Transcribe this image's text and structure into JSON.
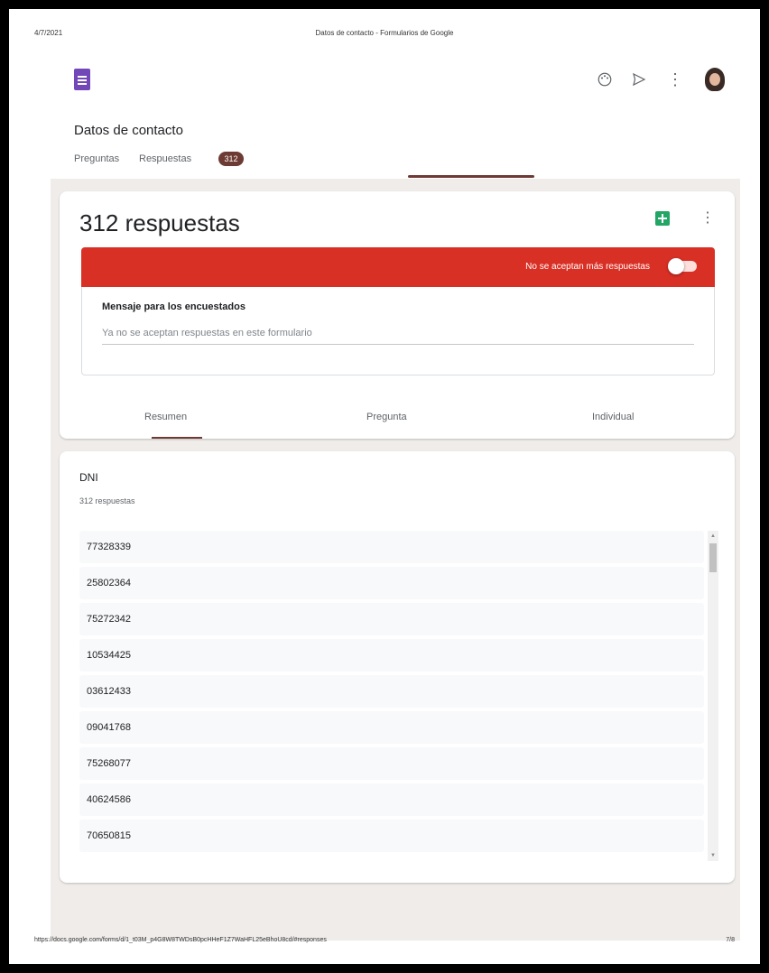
{
  "print": {
    "date": "4/7/2021",
    "doc_title": "Datos de contacto - Formularios de Google",
    "url": "https://docs.google.com/forms/d/1_t03M_p4G8W8TWDsB0pcHHeF1Z7WaHFL25eBhoU8cd/#responses",
    "page": "7/8"
  },
  "header": {
    "form_title": "Datos de contacto",
    "tab_questions": "Preguntas",
    "tab_responses": "Respuestas",
    "responses_badge": "312"
  },
  "summary_card": {
    "count_label": "312 respuestas",
    "accepting_label": "No se aceptan más respuestas",
    "message_title": "Mensaje para los encuestados",
    "message_value": "Ya no se aceptan respuestas en este formulario",
    "subtabs": [
      "Resumen",
      "Pregunta",
      "Individual"
    ]
  },
  "question": {
    "title": "DNI",
    "count": "312 respuestas",
    "responses": [
      "77328339",
      "25802364",
      "75272342",
      "10534425",
      "03612433",
      "09041768",
      "75268077",
      "40624586",
      "70650815"
    ]
  },
  "colors": {
    "accent": "#6d3b33",
    "banner": "#d93025",
    "forms_purple": "#7248b9",
    "sheets_green": "#23a566"
  }
}
